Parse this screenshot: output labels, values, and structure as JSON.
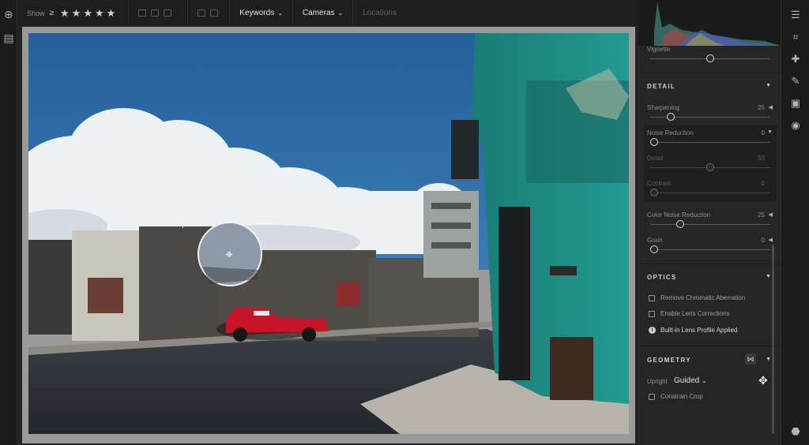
{
  "toolbar": {
    "show_label": "Show",
    "flag_value": "≥",
    "stars": [
      "★",
      "★",
      "★",
      "★",
      "★"
    ],
    "keywords_label": "Keywords",
    "cameras_label": "Cameras",
    "locations_label": "Locations",
    "chevron": "⌄"
  },
  "left_rail": {
    "add_icon": "⊕",
    "library_icon": "▤"
  },
  "right_rail": {
    "icons": [
      "sliders-icon",
      "crop-icon",
      "healing-icon",
      "brush-icon",
      "linear-gradient-icon",
      "radial-gradient-icon",
      "tag-icon"
    ]
  },
  "panel": {
    "vignette_label": "Vignette",
    "detail": {
      "title": "DETAIL",
      "sharpening": {
        "label": "Sharpening",
        "value": "25"
      },
      "noise_reduction": {
        "label": "Noise Reduction",
        "value": "0"
      },
      "detail": {
        "label": "Detail",
        "value": "50"
      },
      "contrast": {
        "label": "Contrast",
        "value": "0"
      },
      "color_noise": {
        "label": "Color Noise Reduction",
        "value": "25"
      },
      "grain": {
        "label": "Grain",
        "value": "0"
      }
    },
    "optics": {
      "title": "OPTICS",
      "remove_ca": "Remove Chromatic Aberration",
      "enable_lens": "Enable Lens Corrections",
      "lens_profile": "Built-in Lens Profile Applied"
    },
    "geometry": {
      "title": "GEOMETRY",
      "upright_label": "Upright",
      "upright_value": "Guided",
      "constrain_crop": "Constrain Crop"
    }
  },
  "colors": {
    "sky": "#2f6ea8",
    "teal_building": "#1f8f87",
    "red_car": "#c8142b",
    "panel_bg": "#262626"
  },
  "slider_levels": {
    "vignette": 0.5,
    "sharpening": 0.17,
    "noise_reduction": 0.0,
    "detail": 0.5,
    "contrast": 0.0,
    "color_noise": 0.25,
    "grain": 0.0
  }
}
